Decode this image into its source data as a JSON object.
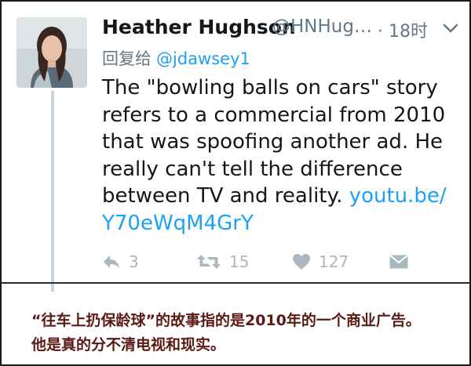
{
  "tweet": {
    "author_name": "Heather Hughson",
    "author_handle": "@HNHug…",
    "timestamp": "· 18时",
    "reply_prefix": "回复给",
    "reply_to": "@jdawsey1",
    "text": "The \"bowling balls on cars\" story refers to a commercial from 2010 that was spoofing another ad. He really can't tell the difference between TV and reality. ",
    "link": "youtu.be/ Y70eWqM4GrY",
    "actions": {
      "reply_icon": "reply-icon",
      "reply_count": "3",
      "retweet_icon": "retweet-icon",
      "retweet_count": "15",
      "like_icon": "heart-icon",
      "like_count": "127",
      "dm_icon": "envelope-icon"
    },
    "menu_icon": "chevron-down-icon"
  },
  "caption": {
    "line1": "“往车上扔保龄球”的故事指的是2010年的一个商业广告。",
    "line2": "他是真的分不清电视和现实。"
  },
  "colors": {
    "link": "#1da1f2",
    "muted": "#657786",
    "action_icon": "#aab8c2",
    "caption_text": "#5b1a14"
  }
}
